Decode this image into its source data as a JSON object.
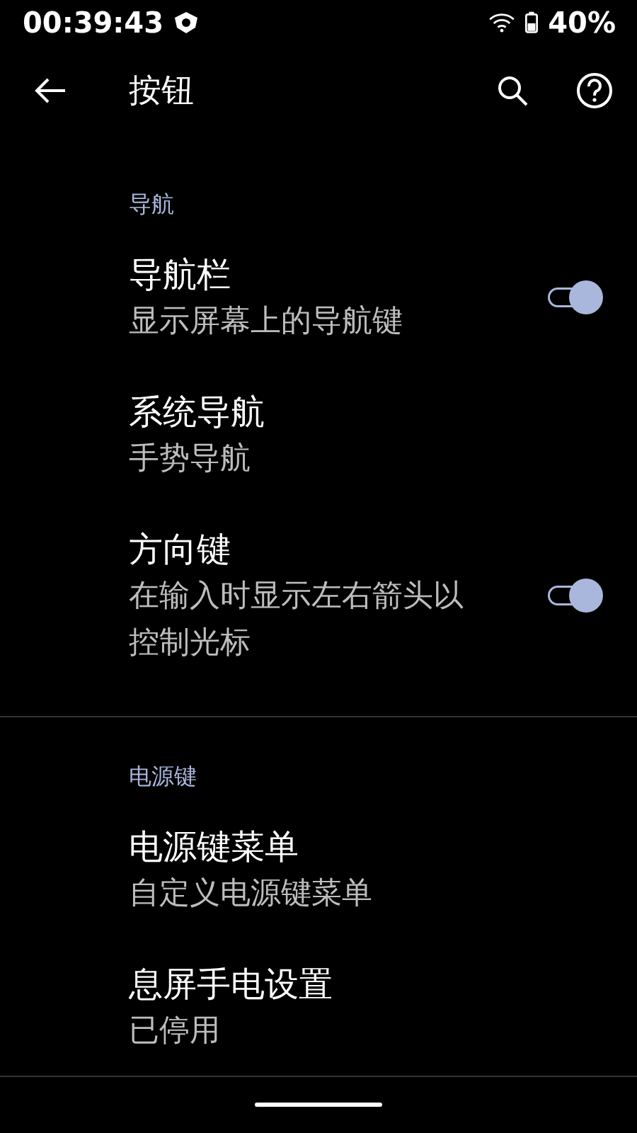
{
  "status_bar": {
    "time": "00:39:43",
    "battery": "40%"
  },
  "toolbar": {
    "title": "按钮"
  },
  "sections": [
    {
      "header": "导航",
      "items": [
        {
          "title": "导航栏",
          "subtitle": "显示屏幕上的导航键",
          "kind": "switch",
          "on": true
        },
        {
          "title": "系统导航",
          "subtitle": "手势导航",
          "kind": "plain"
        },
        {
          "title": "方向键",
          "subtitle": "在输入时显示左右箭头以控制光标",
          "kind": "switch",
          "on": true
        }
      ]
    },
    {
      "header": "电源键",
      "items": [
        {
          "title": "电源键菜单",
          "subtitle": "自定义电源键菜单",
          "kind": "plain"
        },
        {
          "title": "息屏手电设置",
          "subtitle": "已停用",
          "kind": "plain"
        }
      ]
    }
  ]
}
